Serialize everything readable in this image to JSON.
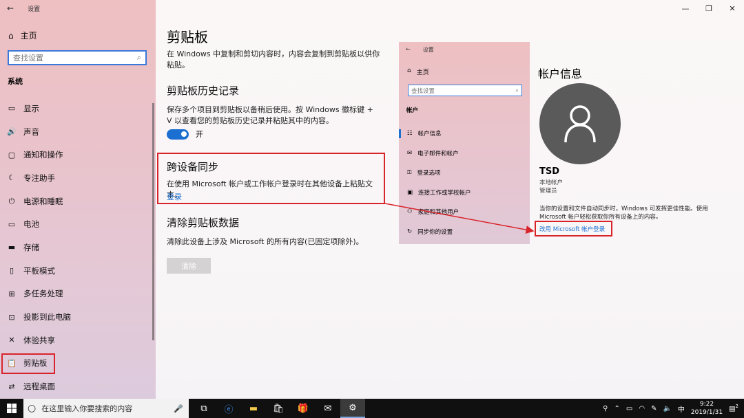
{
  "sidebar": {
    "app_title": "设置",
    "home_label": "主页",
    "search_placeholder": "查找设置",
    "section": "系统",
    "items": [
      {
        "label": "显示",
        "icon": "display-icon"
      },
      {
        "label": "声音",
        "icon": "sound-icon"
      },
      {
        "label": "通知和操作",
        "icon": "notification-icon"
      },
      {
        "label": "专注助手",
        "icon": "moon-icon"
      },
      {
        "label": "电源和睡眠",
        "icon": "power-icon"
      },
      {
        "label": "电池",
        "icon": "battery-icon"
      },
      {
        "label": "存储",
        "icon": "storage-icon"
      },
      {
        "label": "平板模式",
        "icon": "tablet-icon"
      },
      {
        "label": "多任务处理",
        "icon": "multitask-icon"
      },
      {
        "label": "投影到此电脑",
        "icon": "project-icon"
      },
      {
        "label": "体验共享",
        "icon": "share-icon"
      },
      {
        "label": "剪贴板",
        "icon": "clipboard-icon",
        "selected": true
      },
      {
        "label": "远程桌面",
        "icon": "remote-icon"
      }
    ]
  },
  "main": {
    "title": "剪贴板",
    "intro": "在 Windows 中复制和剪切内容时，内容会复制到剪贴板以供你粘贴。",
    "history": {
      "heading": "剪贴板历史记录",
      "desc": "保存多个项目到剪贴板以备稍后使用。按 Windows 徽标键 + V 以查看您的剪贴板历史记录并粘贴其中的内容。",
      "toggle_label": "开",
      "toggle_on": true
    },
    "sync": {
      "heading": "跨设备同步",
      "desc": "在使用 Microsoft 帐户或工作帐户登录时在其他设备上粘贴文本。",
      "link": "登录"
    },
    "clear": {
      "heading": "清除剪贴板数据",
      "desc": "清除此设备上涉及 Microsoft 的所有内容(已固定项除外)。",
      "button": "清除"
    }
  },
  "inset": {
    "app_title": "设置",
    "home_label": "主页",
    "search_placeholder": "查找设置",
    "section": "帐户",
    "items": [
      {
        "label": "帐户信息",
        "icon": "person-card-icon",
        "active": true
      },
      {
        "label": "电子邮件和帐户",
        "icon": "mail-icon"
      },
      {
        "label": "登录选项",
        "icon": "key-icon"
      },
      {
        "label": "连接工作或学校帐户",
        "icon": "briefcase-icon"
      },
      {
        "label": "家庭和其他用户",
        "icon": "family-icon"
      },
      {
        "label": "同步你的设置",
        "icon": "sync-icon"
      }
    ]
  },
  "account": {
    "title": "帐户信息",
    "name": "TSD",
    "type": "本地帐户",
    "role": "管理员",
    "desc": "当你的设置和文件自动同步时，Windows 可发挥更佳性能。使用 Microsoft 帐户轻松获取你所有设备上的内容。",
    "link": "改用 Microsoft 帐户登录"
  },
  "taskbar": {
    "search_placeholder": "在这里输入你要搜索的内容",
    "time": "9:22",
    "date": "2019/1/31",
    "ime": "中",
    "badge": "2"
  },
  "colors": {
    "accent": "#1a6fd1",
    "highlight_red": "#d9232a"
  }
}
